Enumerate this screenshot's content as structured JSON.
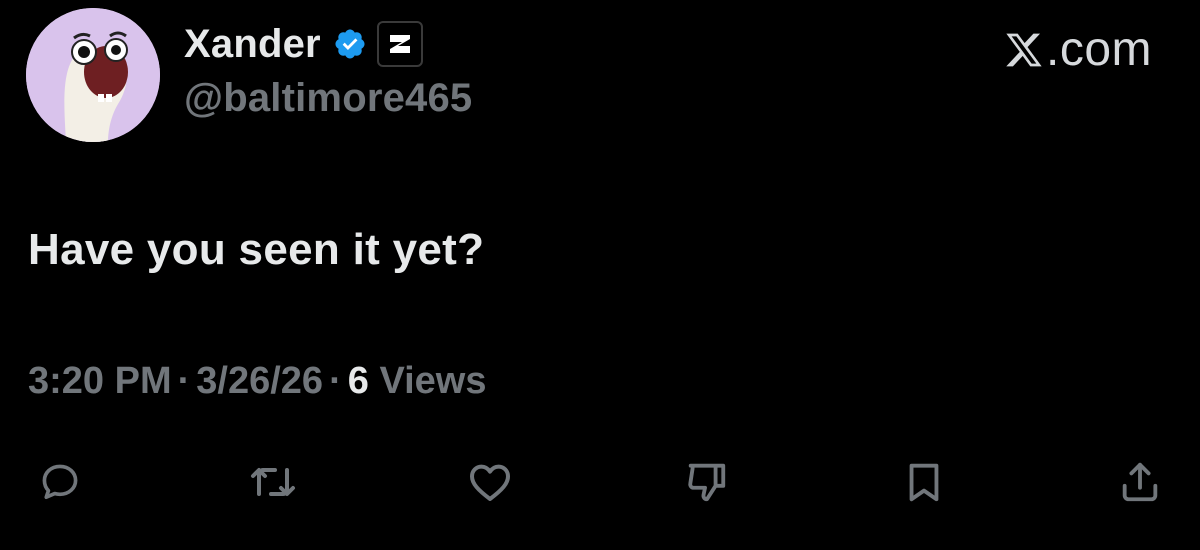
{
  "author": {
    "display_name": "Xander",
    "handle": "@baltimore465",
    "verified": true,
    "avatar": "cartoon-sock-puppet-avatar",
    "affiliate_badge": "z-logo-badge"
  },
  "brand": {
    "text": ".com",
    "icon": "x-logo-icon"
  },
  "tweet": {
    "text": "Have you seen it yet?",
    "time": "3:20 PM",
    "separator": "·",
    "date": "3/26/26",
    "views_count": "6",
    "views_label": "Views"
  },
  "actions": [
    {
      "name": "reply",
      "icon": "reply-icon"
    },
    {
      "name": "retweet",
      "icon": "retweet-icon"
    },
    {
      "name": "like",
      "icon": "heart-icon"
    },
    {
      "name": "dislike",
      "icon": "thumbs-down-icon"
    },
    {
      "name": "bookmark",
      "icon": "bookmark-icon"
    },
    {
      "name": "share",
      "icon": "share-icon"
    }
  ],
  "colors": {
    "background": "#000000",
    "primary_text": "#e7e9ea",
    "secondary_text": "#71767b",
    "verified_blue": "#1d9bf0",
    "avatar_bg": "#d9c3ec"
  }
}
